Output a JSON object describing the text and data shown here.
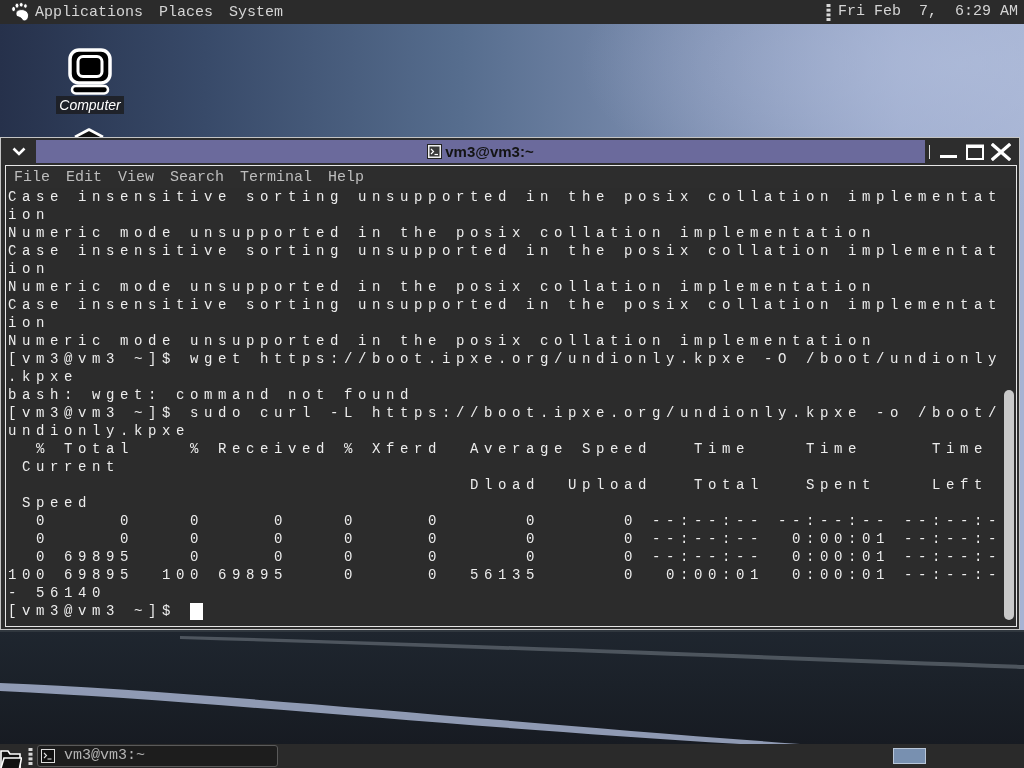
{
  "top_panel": {
    "menus": [
      "Applications",
      "Places",
      "System"
    ],
    "clock": "Fri Feb  7,  6:29 AM"
  },
  "desktop_icons": [
    {
      "label": "Computer"
    }
  ],
  "window": {
    "title": "vm3@vm3:~",
    "menu": [
      "File",
      "Edit",
      "View",
      "Search",
      "Terminal",
      "Help"
    ],
    "terminal": {
      "lines": [
        "Case insensitive sorting unsupported in the posix collation implementat",
        "ion",
        "Numeric mode unsupported in the posix collation implementation",
        "Case insensitive sorting unsupported in the posix collation implementat",
        "ion",
        "Numeric mode unsupported in the posix collation implementation",
        "Case insensitive sorting unsupported in the posix collation implementat",
        "ion",
        "Numeric mode unsupported in the posix collation implementation",
        "[vm3@vm3 ~]$ wget https://boot.ipxe.org/undionly.kpxe -O /boot/undionly",
        ".kpxe",
        "bash: wget: command not found",
        "[vm3@vm3 ~]$ sudo curl -L https://boot.ipxe.org/undionly.kpxe -o /boot/",
        "undionly.kpxe",
        "  % Total    % Received % Xferd  Average Speed   Time    Time     Time",
        " Current",
        "                                 Dload  Upload   Total   Spent    Left",
        " Speed",
        "  0     0    0     0    0     0      0      0 --:--:-- --:--:-- --:--:-",
        "  0     0    0     0    0     0      0      0 --:--:--  0:00:01 --:--:-",
        "  0 69895    0     0    0     0      0      0 --:--:--  0:00:01 --:--:-",
        "100 69895  100 69895    0     0  56135      0  0:00:01  0:00:01 --:--:-",
        "- 56140",
        "[vm3@vm3 ~]$"
      ],
      "cursor": true
    }
  },
  "taskbar": {
    "tasks": [
      {
        "label": "vm3@vm3:~",
        "selected": true
      }
    ]
  }
}
